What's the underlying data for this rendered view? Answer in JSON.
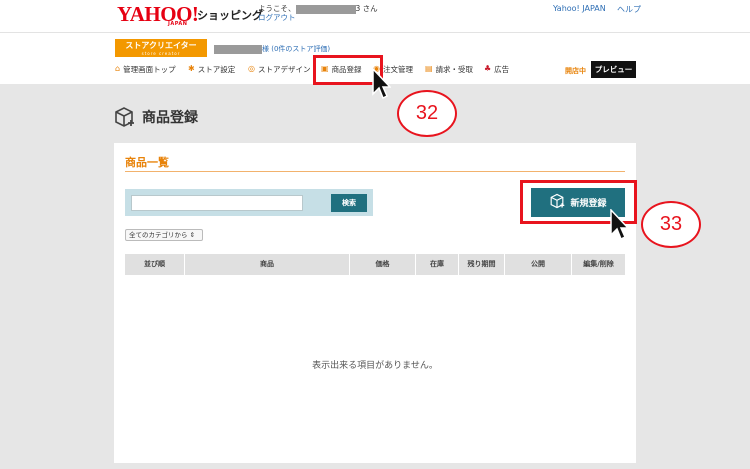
{
  "header": {
    "logo_text": "YAHOO!",
    "logo_sub": "JAPAN",
    "shopping": "ショッピング",
    "welcome_prefix": "ようこそ、",
    "welcome_suffix": "3 さん",
    "logout": "ログアウト",
    "yahoo_link": "Yahoo! JAPAN",
    "help_link": "ヘルプ"
  },
  "store_bar": {
    "store_creator_label": "ストアクリエイター",
    "store_creator_sub": "store creator",
    "rating_text": "様 (0件のストア評価)"
  },
  "nav": {
    "items": [
      {
        "label": "管理画面トップ",
        "icon": "home-icon",
        "color": "#e8830a"
      },
      {
        "label": "ストア設定",
        "icon": "tools-icon",
        "color": "#e8830a"
      },
      {
        "label": "ストアデザイン",
        "icon": "design-icon",
        "color": "#e8830a"
      },
      {
        "label": "商品登録",
        "icon": "box-icon",
        "color": "#e8830a"
      },
      {
        "label": "注文管理",
        "icon": "order-icon",
        "color": "#e8830a"
      },
      {
        "label": "請求・受取",
        "icon": "invoice-icon",
        "color": "#e8830a"
      },
      {
        "label": "広告",
        "icon": "ad-icon",
        "color": "#c8192a"
      }
    ],
    "status": "開店中",
    "preview": "プレビュー"
  },
  "annotations": {
    "callout_1": "32",
    "callout_2": "33",
    "highlight_color": "#e8141e"
  },
  "page": {
    "title": "商品登録",
    "section_title": "商品一覧",
    "search_button": "検索",
    "search_value": "",
    "search_placeholder": "",
    "new_button": "新規登録",
    "category_select": "全てのカテゴリから ⇕",
    "columns": [
      "並び順",
      "商品",
      "価格",
      "在庫",
      "残り期間",
      "公開",
      "編集/削除"
    ],
    "empty_message": "表示出来る項目がありません。"
  },
  "colors": {
    "accent_orange": "#f39800",
    "teal_button": "#20707f",
    "link_blue": "#2f6fb5"
  }
}
